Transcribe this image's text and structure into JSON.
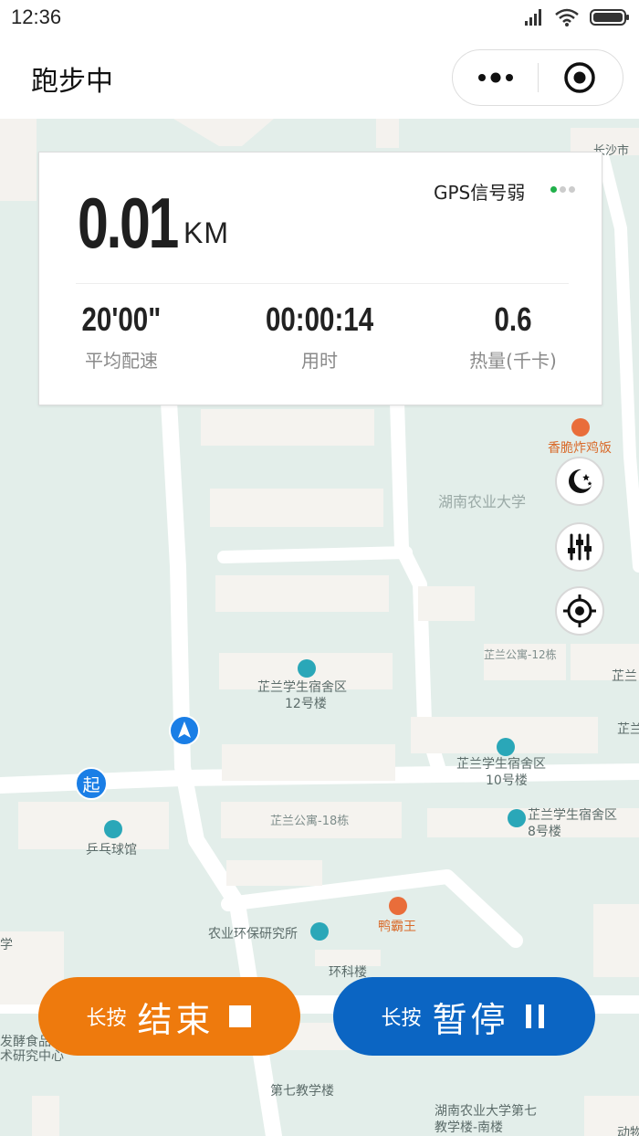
{
  "status_bar": {
    "time": "12:36"
  },
  "header": {
    "title": "跑步中"
  },
  "stats": {
    "distance_value": "0.01",
    "distance_unit": "KM",
    "gps_label": "GPS信号弱",
    "gps_strength_level": 1,
    "gps_strength_max": 3,
    "pace_value": "20'00\"",
    "pace_label": "平均配速",
    "duration_value": "00:00:14",
    "duration_label": "用时",
    "calories_value": "0.6",
    "calories_label": "热量(千卡)"
  },
  "map": {
    "start_marker": "起",
    "labels": [
      {
        "id": "changsha",
        "text": "长沙市"
      },
      {
        "id": "xiangcui",
        "text": "香脆炸鸡饭"
      },
      {
        "id": "hunan-agri",
        "text": "湖南农业大学"
      },
      {
        "id": "zhilan-12dong",
        "text": "芷兰公寓-12栋"
      },
      {
        "id": "zhilan-12-a",
        "text": "芷兰学生宿舍区"
      },
      {
        "id": "zhilan-12-b",
        "text": "12号楼"
      },
      {
        "id": "zhilan-10-a",
        "text": "芷兰学生宿舍区"
      },
      {
        "id": "zhilan-10-b",
        "text": "10号楼"
      },
      {
        "id": "zhilan-8-a",
        "text": "芷兰学生宿舍区"
      },
      {
        "id": "zhilan-8-b",
        "text": "8号楼"
      },
      {
        "id": "zhilan-18dong",
        "text": "芷兰公寓-18栋"
      },
      {
        "id": "pingpong",
        "text": "乒乓球馆"
      },
      {
        "id": "yabawang",
        "text": "鸭霸王"
      },
      {
        "id": "huanbao",
        "text": "农业环保研究所"
      },
      {
        "id": "huanke",
        "text": "环科楼"
      },
      {
        "id": "jiao7",
        "text": "第七教学楼"
      },
      {
        "id": "nanlou-a",
        "text": "湖南农业大学第七"
      },
      {
        "id": "nanlou-b",
        "text": "教学楼-南楼"
      },
      {
        "id": "fajiao-a",
        "text": "发酵食品"
      },
      {
        "id": "fajiao-b",
        "text": "术研究中心"
      },
      {
        "id": "edge-xue",
        "text": "学"
      },
      {
        "id": "edge-zhilan1",
        "text": "芷兰"
      },
      {
        "id": "edge-zhilan2",
        "text": "芷兰"
      },
      {
        "id": "edge-dongwu",
        "text": "动物"
      }
    ]
  },
  "buttons": {
    "end_hint": "长按",
    "end_label": "结束",
    "pause_hint": "长按",
    "pause_label": "暂停"
  },
  "colors": {
    "end_button": "#ee7a0d",
    "pause_button": "#0b65c3",
    "gps_active": "#21b04b",
    "gps_inactive": "#cccccc",
    "map_bg": "#e3eeea"
  },
  "icons": [
    "signal-icon",
    "wifi-icon",
    "battery-icon",
    "more-icon",
    "target-icon",
    "night-mode-icon",
    "settings-icon",
    "locate-icon",
    "navigation-arrow-icon",
    "stop-icon",
    "pause-icon"
  ]
}
